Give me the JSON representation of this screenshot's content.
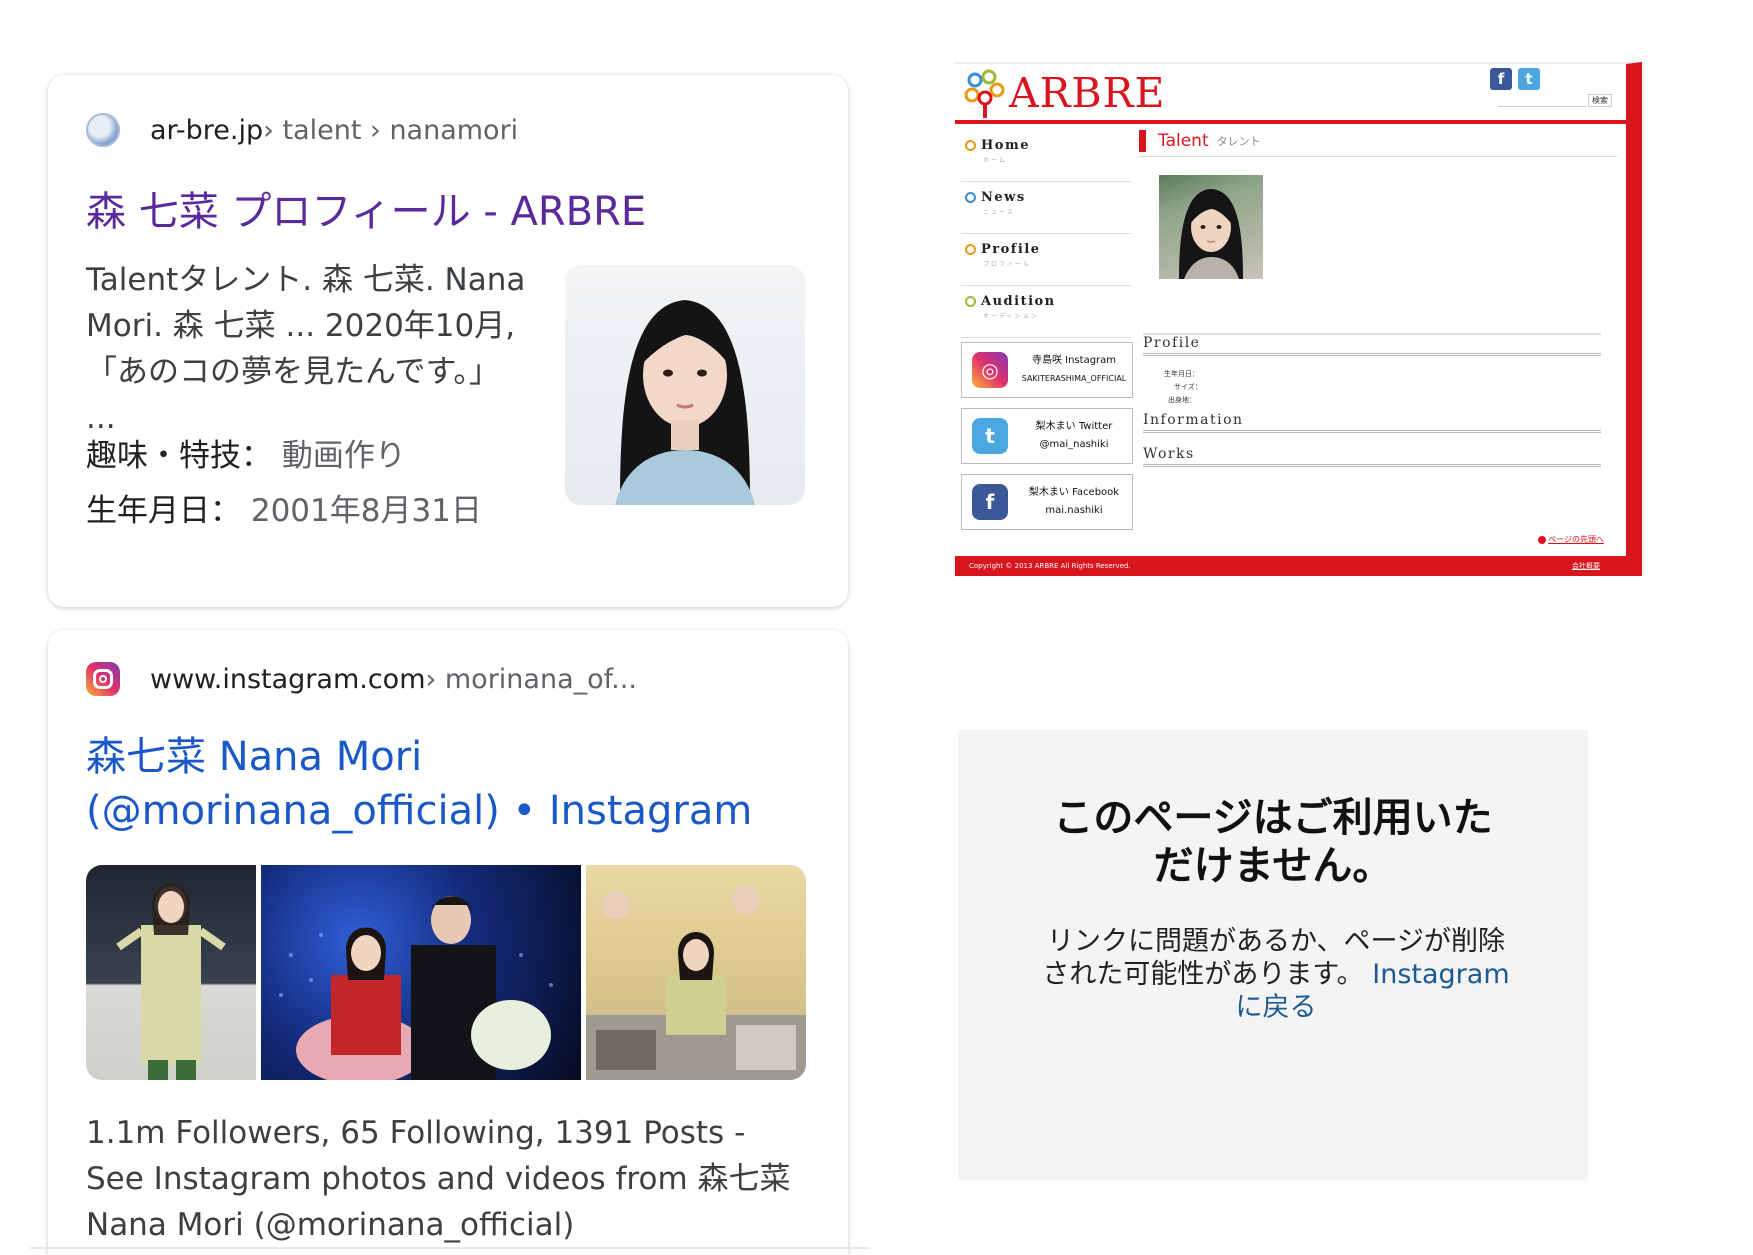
{
  "result1": {
    "site": "ar-bre.jp",
    "crumbs": " › talent › nanamori",
    "title": "森 七菜 プロフィール - ARBRE",
    "snippet": "Talentタレント. 森 七菜. Nana Mori. 森 七菜 ... 2020年10月, 「あのコの夢を見たんです。」 ...",
    "facts": [
      {
        "label": "趣味・特技：",
        "value": "動画作り"
      },
      {
        "label": "生年月日：",
        "value": "2001年8月31日"
      }
    ]
  },
  "result2": {
    "site": "www.instagram.com",
    "crumbs": " › morinana_of...",
    "title": "森七菜 Nana Mori (@morinana_official) • Instagram ...",
    "description": "1.1m Followers, 65 Following, 1391 Posts - See Instagram photos and videos from 森七菜 Nana Mori (@morinana_official)"
  },
  "arbre_site": {
    "logo_text": "ARBRE",
    "search_button": "検索",
    "nav": [
      {
        "label": "Home",
        "sub": "ホーム"
      },
      {
        "label": "News",
        "sub": "ニュース"
      },
      {
        "label": "Profile",
        "sub": "プロフィール"
      },
      {
        "label": "Audition",
        "sub": "オーディション"
      }
    ],
    "social": [
      {
        "line1": "寺島咲 Instagram",
        "line2": "SAKITERASHIMA_OFFICIAL"
      },
      {
        "line1": "梨木まい Twitter",
        "line2": "@mai_nashiki"
      },
      {
        "line1": "梨木まい Facebook",
        "line2": "mai.nashiki"
      }
    ],
    "section_title": "Talent",
    "section_title_kana": "タレント",
    "sections": [
      "Profile",
      "Information",
      "Works"
    ],
    "profile_fields": [
      "生年月日：",
      "サイズ：",
      "出身地："
    ],
    "page_top": "ページの先頭へ",
    "copyright": "Copyright © 2013 ARBRE All Rights Reserved.",
    "company_link": "会社概要",
    "colors": {
      "brand_red": "#d8141c"
    }
  },
  "ig_error": {
    "heading": "このページはご利用いただけません。",
    "body": "リンクに問題があるか、ページが削除された可能性があります。",
    "back_link": "Instagramに戻る"
  }
}
